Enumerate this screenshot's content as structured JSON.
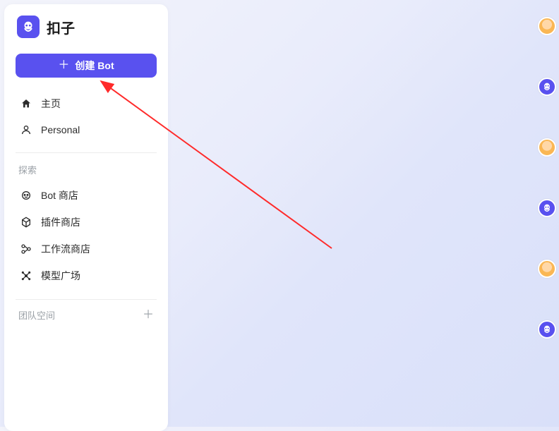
{
  "brand": {
    "name": "扣子"
  },
  "create_button": {
    "label": "创建 Bot"
  },
  "nav": {
    "home": "主页",
    "personal": "Personal"
  },
  "explore": {
    "label": "探索",
    "items": {
      "bot_store": "Bot 商店",
      "plugin_store": "插件商店",
      "workflow_store": "工作流商店",
      "model_arena": "模型广场"
    }
  },
  "team_space": {
    "label": "团队空间"
  },
  "colors": {
    "accent": "#5951ef"
  }
}
